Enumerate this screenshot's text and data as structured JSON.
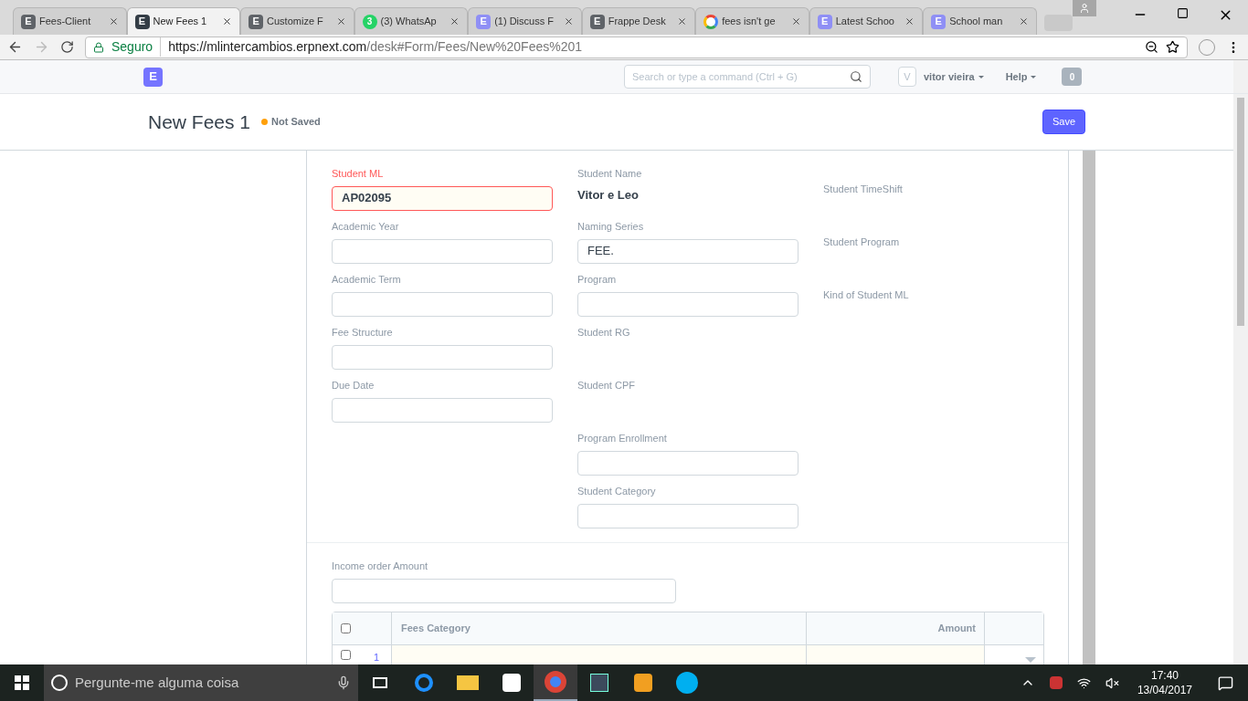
{
  "browser": {
    "tabs": [
      {
        "title": "Fees-Client",
        "favicon": {
          "kind": "letter",
          "text": "E",
          "color": "#5f6368"
        },
        "selected": false
      },
      {
        "title": "New Fees 1",
        "favicon": {
          "kind": "letter",
          "text": "E",
          "color": "#343d46"
        },
        "selected": true
      },
      {
        "title": "Customize F",
        "favicon": {
          "kind": "letter",
          "text": "E",
          "color": "#5f6368"
        },
        "selected": false
      },
      {
        "title": "(3) WhatsAp",
        "favicon": {
          "kind": "badge",
          "text": "3",
          "color": "#25d366"
        },
        "selected": false
      },
      {
        "title": "(1) Discuss F",
        "favicon": {
          "kind": "letter",
          "text": "E",
          "color": "#8f8ff5"
        },
        "selected": false
      },
      {
        "title": "Frappe Desk",
        "favicon": {
          "kind": "letter",
          "text": "E",
          "color": "#5f6368"
        },
        "selected": false
      },
      {
        "title": "fees isn't ge",
        "favicon": {
          "kind": "google"
        },
        "selected": false
      },
      {
        "title": "Latest Schoo",
        "favicon": {
          "kind": "letter",
          "text": "E",
          "color": "#8f8ff5"
        },
        "selected": false
      },
      {
        "title": "School man",
        "favicon": {
          "kind": "letter",
          "text": "E",
          "color": "#8f8ff5"
        },
        "selected": false
      }
    ],
    "secure_label": "Seguro",
    "url_host": "https://mlintercambios.erpnext.com",
    "url_path": "/desk#Form/Fees/New%20Fees%201"
  },
  "navbar": {
    "logo": "E",
    "search_placeholder": "Search or type a command (Ctrl + G)",
    "avatar": "V",
    "user": "vitor vieira",
    "help": "Help",
    "notifications": "0"
  },
  "page": {
    "title": "New Fees 1",
    "status": "Not Saved",
    "primary_action": "Save"
  },
  "form": {
    "columns": [
      [
        {
          "label": "Student ML",
          "kind": "input",
          "value": "AP02095",
          "required": true
        },
        {
          "label": "Academic Year",
          "kind": "input",
          "required": false
        },
        {
          "label": "Academic Term",
          "kind": "input",
          "required": false
        },
        {
          "label": "Fee Structure",
          "kind": "input",
          "required": false
        },
        {
          "label": "Due Date",
          "kind": "input",
          "required": false
        }
      ],
      [
        {
          "label": "Student Name",
          "kind": "readonly",
          "value": "Vitor e Leo",
          "required": false
        },
        {
          "label": "Naming Series",
          "kind": "input",
          "value": "FEE.",
          "required": false
        },
        {
          "label": "Program",
          "kind": "input",
          "required": false
        },
        {
          "label": "Student RG",
          "kind": "empty",
          "required": false
        },
        {
          "label": "Student CPF",
          "kind": "empty",
          "required": false
        },
        {
          "label": "Program Enrollment",
          "kind": "input",
          "required": false
        },
        {
          "label": "Student Category",
          "kind": "input",
          "required": false
        }
      ],
      [
        {
          "label": "Student TimeShift",
          "kind": "empty",
          "required": false
        },
        {
          "label": "Student Program",
          "kind": "empty",
          "required": false
        },
        {
          "label": "Kind of Student ML",
          "kind": "empty",
          "required": false
        }
      ]
    ],
    "section2": {
      "label": "Income order Amount"
    },
    "table": {
      "columns": [
        "Fees Category",
        "Amount"
      ],
      "rows": [
        {
          "index": "1",
          "checked": false
        }
      ],
      "all_checked": false
    }
  },
  "taskbar": {
    "search_placeholder": "Pergunte-me alguma coisa",
    "apps": [
      {
        "kind": "taskview",
        "selected": false
      },
      {
        "kind": "edge",
        "selected": false
      },
      {
        "kind": "explorer",
        "selected": false
      },
      {
        "kind": "store",
        "selected": false
      },
      {
        "kind": "chrome",
        "selected": true
      },
      {
        "kind": "app",
        "selected": false
      },
      {
        "kind": "sublime",
        "selected": false
      },
      {
        "kind": "skype",
        "selected": false
      }
    ],
    "time": "17:40",
    "date": "13/04/2017"
  }
}
